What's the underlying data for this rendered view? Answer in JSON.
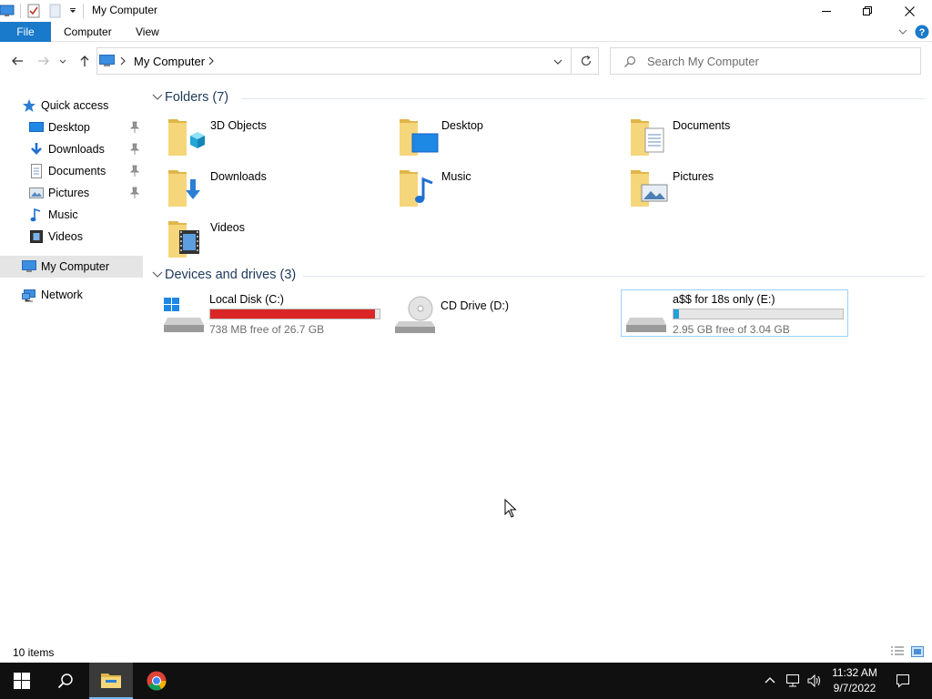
{
  "window": {
    "title": "My Computer",
    "controls": [
      "minimize",
      "restore",
      "close"
    ]
  },
  "ribbon": {
    "tabs": [
      "File",
      "Computer",
      "View"
    ]
  },
  "address": {
    "path_label": "My Computer",
    "search_placeholder": "Search My Computer"
  },
  "navpane": {
    "quick_access": "Quick access",
    "items": [
      {
        "label": "Desktop",
        "icon": "desktop-icon",
        "pinned": true
      },
      {
        "label": "Downloads",
        "icon": "downloads-icon",
        "pinned": true
      },
      {
        "label": "Documents",
        "icon": "documents-icon",
        "pinned": true
      },
      {
        "label": "Pictures",
        "icon": "pictures-icon",
        "pinned": true
      },
      {
        "label": "Music",
        "icon": "music-icon",
        "pinned": false
      },
      {
        "label": "Videos",
        "icon": "videos-icon",
        "pinned": false
      }
    ],
    "my_computer": "My Computer",
    "network": "Network"
  },
  "folders": {
    "title": "Folders (7)",
    "items": [
      {
        "label": "3D Objects",
        "icon": "3d-objects-folder-icon"
      },
      {
        "label": "Desktop",
        "icon": "desktop-folder-icon"
      },
      {
        "label": "Documents",
        "icon": "documents-folder-icon"
      },
      {
        "label": "Downloads",
        "icon": "downloads-folder-icon"
      },
      {
        "label": "Music",
        "icon": "music-folder-icon"
      },
      {
        "label": "Pictures",
        "icon": "pictures-folder-icon"
      },
      {
        "label": "Videos",
        "icon": "videos-folder-icon"
      }
    ]
  },
  "drives": {
    "title": "Devices and drives (3)",
    "items": [
      {
        "name": "Local Disk (C:)",
        "free": "738 MB free of 26.7 GB",
        "used_fraction": 0.973,
        "bar_color": "#da2626",
        "icon": "windows-drive-icon"
      },
      {
        "name": "CD Drive (D:)",
        "free": "",
        "used_fraction": null,
        "bar_color": null,
        "icon": "cd-drive-icon"
      },
      {
        "name": "a$$ for 18s only (E:)",
        "free": "2.95 GB free of 3.04 GB",
        "used_fraction": 0.03,
        "bar_color": "#26a0da",
        "icon": "removable-drive-icon"
      }
    ]
  },
  "status": {
    "items_count": "10 items"
  },
  "taskbar": {
    "apps": [
      "start-icon",
      "search-icon",
      "file-explorer-icon",
      "chrome-icon"
    ],
    "time": "11:32 AM",
    "date": "9/7/2022"
  },
  "colors": {
    "accent": "#1979ca",
    "selection": "#cce8ff",
    "drive_full": "#da2626",
    "drive_normal": "#26a0da"
  }
}
